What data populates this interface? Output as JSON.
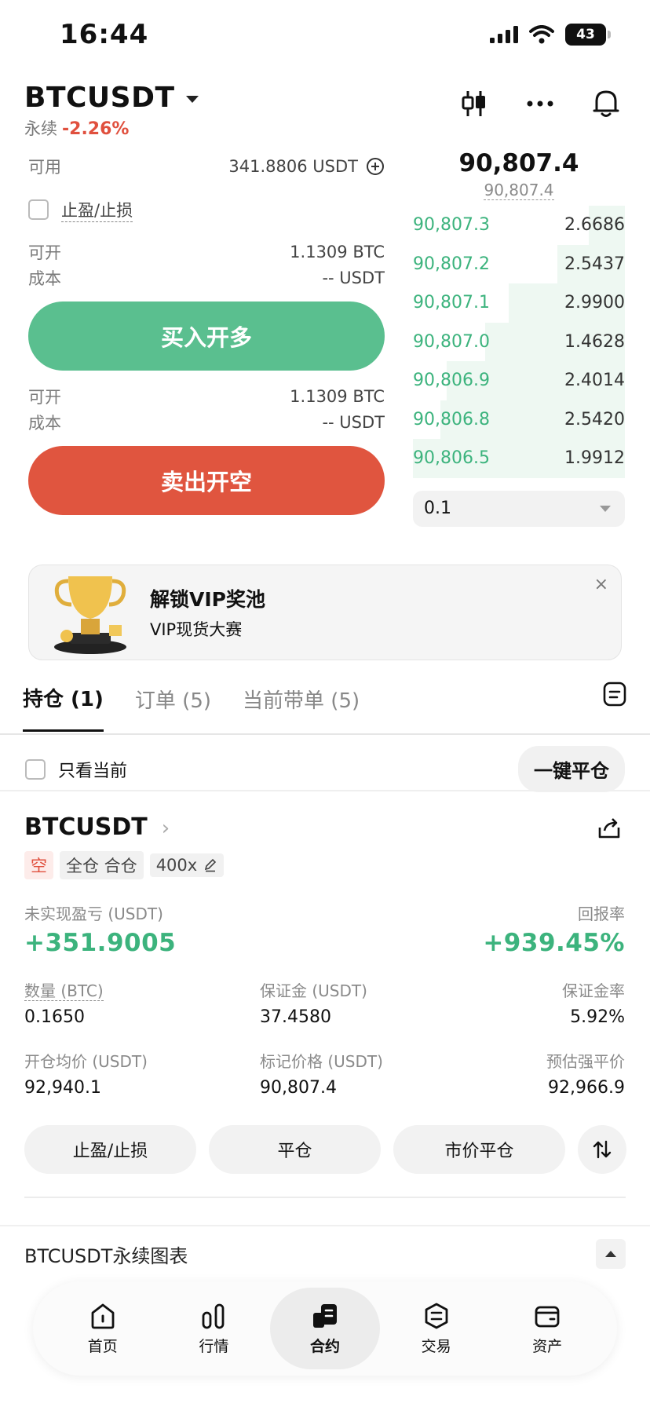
{
  "status_bar": {
    "time": "16:44",
    "battery": "43"
  },
  "header": {
    "pair": "BTCUSDT",
    "type": "永续",
    "change_pct": "-2.26%"
  },
  "form": {
    "available_label": "可用",
    "available_value": "341.8806 USDT",
    "tpsl_label": "止盈/止损",
    "buy_block": {
      "open_label": "可开",
      "open_value": "1.1309 BTC",
      "cost_label": "成本",
      "cost_value": "-- USDT"
    },
    "buy_button": "买入开多",
    "sell_block": {
      "open_label": "可开",
      "open_value": "1.1309 BTC",
      "cost_label": "成本",
      "cost_value": "-- USDT"
    },
    "sell_button": "卖出开空"
  },
  "order_book": {
    "last_price": "90,807.4",
    "mark_price": "90,807.4",
    "rows": [
      {
        "price": "90,807.3",
        "size": "2.6686",
        "depth": 0.17
      },
      {
        "price": "90,807.2",
        "size": "2.5437",
        "depth": 0.32
      },
      {
        "price": "90,807.1",
        "size": "2.9900",
        "depth": 0.55
      },
      {
        "price": "90,807.0",
        "size": "1.4628",
        "depth": 0.66
      },
      {
        "price": "90,806.9",
        "size": "2.4014",
        "depth": 0.84
      },
      {
        "price": "90,806.8",
        "size": "2.5420",
        "depth": 0.87
      },
      {
        "price": "90,806.5",
        "size": "1.9912",
        "depth": 1.0
      }
    ],
    "precision": "0.1"
  },
  "banner": {
    "title": "解锁VIP奖池",
    "subtitle": "VIP现货大赛",
    "close": "×"
  },
  "tabs": [
    {
      "label": "持仓 (1)",
      "active": true
    },
    {
      "label": "订单 (5)",
      "active": false
    },
    {
      "label": "当前带单 (5)",
      "active": false
    }
  ],
  "filter": {
    "only_current": "只看当前",
    "close_all": "一键平仓"
  },
  "position": {
    "pair": "BTCUSDT",
    "side": "空",
    "margin_mode": "全仓 合仓",
    "leverage": "400x",
    "pnl_label": "未实现盈亏 (USDT)",
    "pnl_value": "+351.9005",
    "roe_label": "回报率",
    "roe_value": "+939.45%",
    "qty_label": "数量 (BTC)",
    "qty_value": "0.1650",
    "margin_label": "保证金 (USDT)",
    "margin_value": "37.4580",
    "margin_ratio_label": "保证金率",
    "margin_ratio_value": "5.92%",
    "entry_label": "开仓均价 (USDT)",
    "entry_value": "92,940.1",
    "mark_label": "标记价格 (USDT)",
    "mark_value": "90,807.4",
    "liq_label": "预估强平价",
    "liq_value": "92,966.9",
    "actions": [
      "止盈/止损",
      "平仓",
      "市价平仓"
    ]
  },
  "chart_section": {
    "title": "BTCUSDT永续图表"
  },
  "nav": [
    {
      "label": "首页",
      "icon": "home-icon",
      "active": false
    },
    {
      "label": "行情",
      "icon": "market-icon",
      "active": false
    },
    {
      "label": "合约",
      "icon": "futures-icon",
      "active": true
    },
    {
      "label": "交易",
      "icon": "trade-icon",
      "active": false
    },
    {
      "label": "资产",
      "icon": "wallet-icon",
      "active": false
    }
  ],
  "colors": {
    "buy": "#5abf8f",
    "sell": "#e0553f",
    "up_text": "#3cb37d",
    "down_text": "#e0503e"
  }
}
